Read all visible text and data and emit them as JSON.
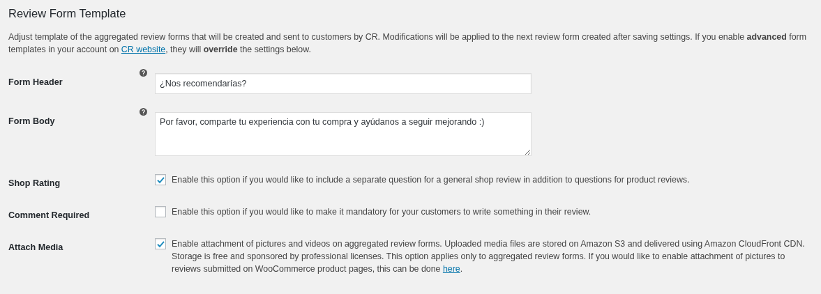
{
  "title": "Review Form Template",
  "intro": {
    "before": "Adjust template of the aggregated review forms that will be created and sent to customers by CR. Modifications will be applied to the next review form created after saving settings. If you enable **advanced** form templates in your account on ",
    "link": "CR website",
    "after": ", they will **override** the settings below."
  },
  "fields": [
    {
      "kind": "text",
      "label": "Form Header",
      "value": "¿Nos recomendarías?"
    },
    {
      "kind": "textarea",
      "label": "Form Body",
      "value": "Por favor, comparte tu experiencia con tu compra y ayúdanos a seguir mejorando :)"
    },
    {
      "kind": "checkbox",
      "label": "Shop Rating",
      "checked": true,
      "text": "Enable this option if you would like to include a separate question for a general shop review in addition to questions for product reviews."
    },
    {
      "kind": "checkbox",
      "label": "Comment Required",
      "checked": false,
      "text": "Enable this option if you would like to make it mandatory for your customers to write something in their review."
    },
    {
      "kind": "checkbox",
      "label": "Attach Media",
      "checked": true,
      "text": "Enable attachment of pictures and videos on aggregated review forms. Uploaded media files are stored on Amazon S3 and delivered using Amazon CloudFront CDN. Storage is free and sponsored by professional licenses. This option applies only to aggregated review forms. If you would like to enable attachment of pictures to reviews submitted on WooCommerce product pages, this can be done ",
      "link": "here",
      "after": "."
    }
  ]
}
